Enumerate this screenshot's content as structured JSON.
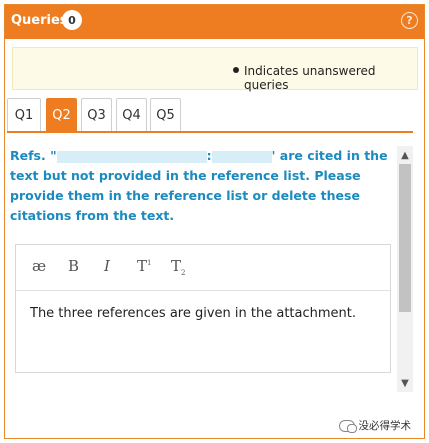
{
  "header": {
    "title": "Queries",
    "count": "0",
    "help_label": "?"
  },
  "legend": {
    "text": "Indicates unanswered queries"
  },
  "tabs": [
    {
      "label": "Q1",
      "active": false
    },
    {
      "label": "Q2",
      "active": true
    },
    {
      "label": "Q3",
      "active": false
    },
    {
      "label": "Q4",
      "active": false
    },
    {
      "label": "Q5",
      "active": false
    }
  ],
  "query": {
    "prefix": "Refs. \"",
    "mid": ":",
    "suffix": "' are cited in the text but not provided in the reference list. Please provide them in the reference list or delete these citations from the text."
  },
  "editor": {
    "toolbar": {
      "ae": "æ",
      "bold": "B",
      "italic": "I",
      "superscript_base": "T",
      "superscript_mark": "1",
      "subscript_base": "T",
      "subscript_mark": "2"
    },
    "answer_text": "The three references are given in the attachment."
  },
  "scrollbar": {
    "up": "▲",
    "down": "▼"
  },
  "watermark": {
    "text": "没必得学术"
  },
  "colors": {
    "accent": "#ee7d22",
    "query_text": "#1b8bbf",
    "legend_bg": "#fdfbe8"
  }
}
